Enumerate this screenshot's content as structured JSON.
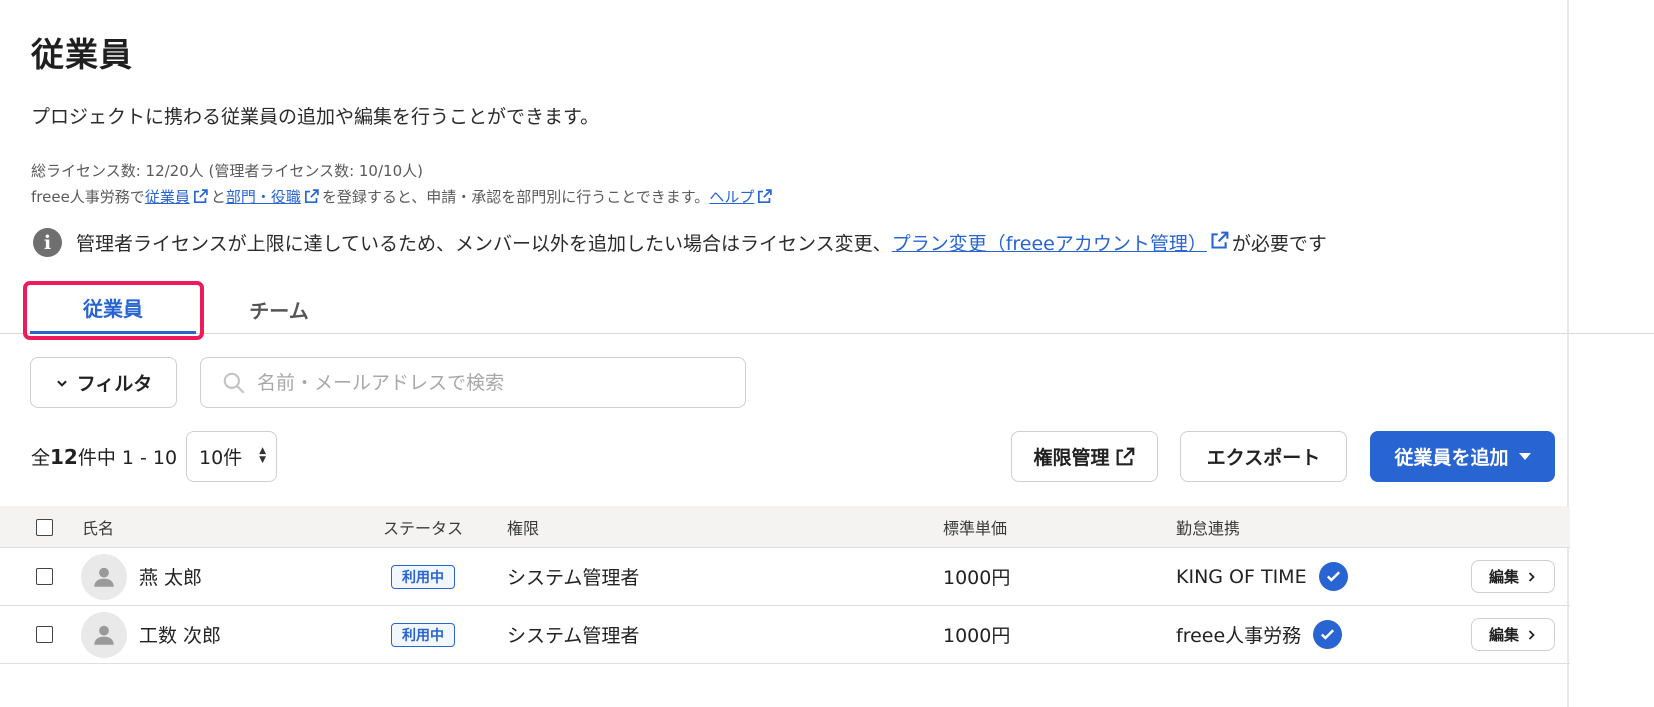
{
  "page": {
    "title": "従業員",
    "description": "プロジェクトに携わる従業員の追加や編集を行うことができます。",
    "license_info": "総ライセンス数: 12/20人 (管理者ライセンス数: 10/10人)",
    "note": {
      "prefix": "freee人事労務で",
      "link_employees": "従業員",
      "and": "と",
      "link_departments": "部門・役職",
      "middle": "を登録すると、申請・承認を部門別に行うことできます。",
      "link_help": "ヘルプ"
    },
    "info_banner": {
      "text": "管理者ライセンスが上限に達しているため、メンバー以外を追加したい場合はライセンス変更、",
      "link": "プラン変更（freeeアカウント管理）",
      "suffix": "が必要です"
    }
  },
  "tabs": [
    {
      "label": "従業員",
      "active": true
    },
    {
      "label": "チーム",
      "active": false
    }
  ],
  "toolbar": {
    "filter_label": "フィルタ",
    "search_placeholder": "名前・メールアドレスで検索"
  },
  "pagination": {
    "prefix": "全",
    "total": "12",
    "suffix": "件中 1 - 10",
    "per_page": "10件"
  },
  "actions": {
    "permissions_label": "権限管理",
    "export_label": "エクスポート",
    "add_label": "従業員を追加"
  },
  "table": {
    "headers": {
      "name": "氏名",
      "status": "ステータス",
      "role": "権限",
      "unit_price": "標準単価",
      "attendance": "勤怠連携"
    },
    "rows": [
      {
        "name": "燕 太郎",
        "status": "利用中",
        "role": "システム管理者",
        "unit_price": "1000円",
        "attendance": "KING OF TIME",
        "edit": "編集"
      },
      {
        "name": "工数 次郎",
        "status": "利用中",
        "role": "システム管理者",
        "unit_price": "1000円",
        "attendance": "freee人事労務",
        "edit": "編集"
      }
    ]
  },
  "colors": {
    "accent": "#2864d2",
    "highlight": "#ee1b5c"
  },
  "icons": [
    "info-icon",
    "external-link-icon",
    "chevron-down-icon",
    "search-icon",
    "caret-down-icon",
    "person-icon",
    "check-circle-icon",
    "chevron-right-icon"
  ]
}
